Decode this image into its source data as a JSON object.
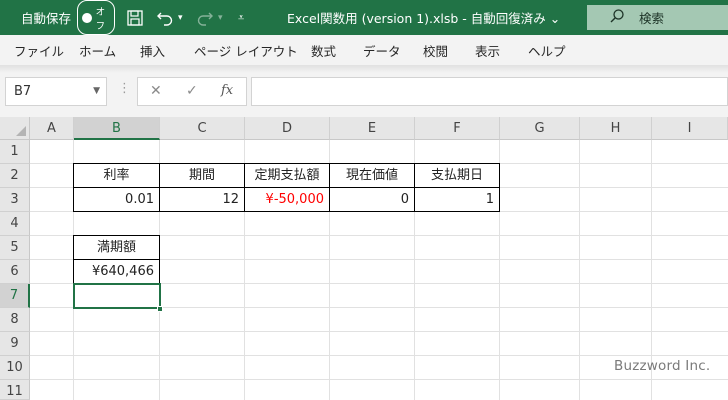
{
  "title_bar": {
    "autosave_label": "自動保存",
    "autosave_state": "オフ",
    "document_title": "Excel関数用 (version 1).xlsb  -  自動回復済み  ⌄",
    "search_label": "検索"
  },
  "ribbon": {
    "tabs": [
      "ファイル",
      "ホーム",
      "挿入",
      "ページ レイアウト",
      "数式",
      "データ",
      "校閲",
      "表示",
      "ヘルプ"
    ]
  },
  "formula_bar": {
    "name_box": "B7",
    "cancel_symbol": "✕",
    "enter_symbol": "✓",
    "fx_symbol": "fx",
    "formula": ""
  },
  "sheet": {
    "columns": [
      "A",
      "B",
      "C",
      "D",
      "E",
      "F",
      "G",
      "H",
      "I"
    ],
    "rows": [
      "1",
      "2",
      "3",
      "4",
      "5",
      "6",
      "7",
      "8",
      "9",
      "10",
      "11"
    ],
    "selected_column": "B",
    "selected_row": "7",
    "cells": {
      "B2": "利率",
      "C2": "期間",
      "D2": "定期支払額",
      "E2": "現在価値",
      "F2": "支払期日",
      "B3": "0.01",
      "C3": "12",
      "D3": "¥-50,000",
      "E3": "0",
      "F3": "1",
      "B5": "満期額",
      "B6": "¥640,466"
    },
    "negative_color": "#ff0000"
  },
  "accent_color": "#217346",
  "watermark": "Buzzword Inc."
}
